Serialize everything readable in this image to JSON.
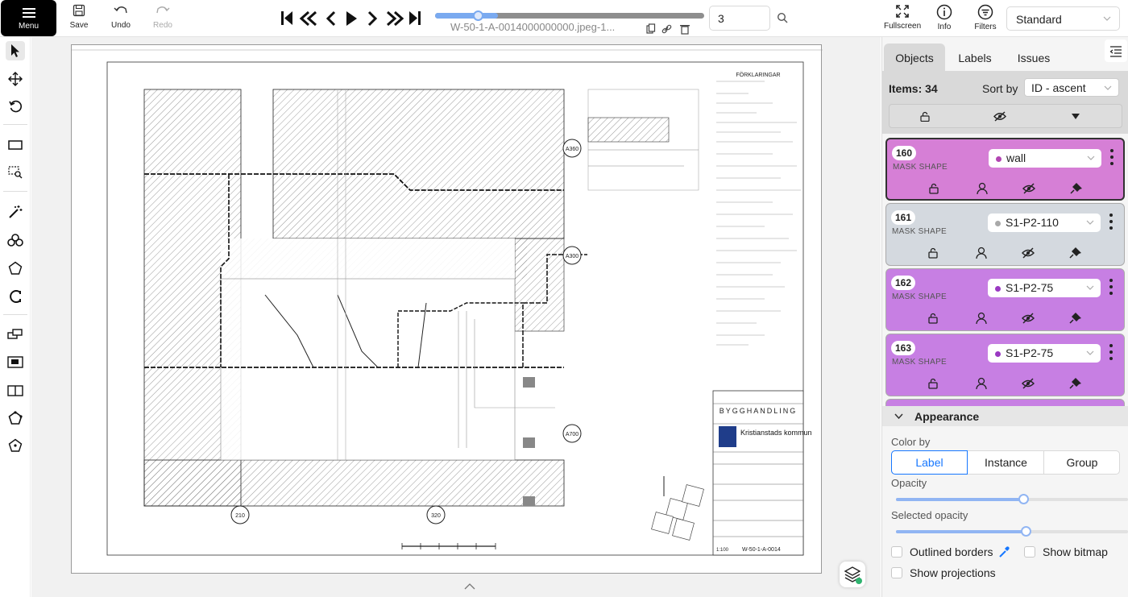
{
  "toolbar": {
    "menu_label": "Menu",
    "save_label": "Save",
    "undo_label": "Undo",
    "redo_label": "Redo",
    "filename": "W-50-1-A-0014000000000.jpeg-1...",
    "frame_value": "3",
    "fullscreen_label": "Fullscreen",
    "info_label": "Info",
    "filters_label": "Filters",
    "workspace_select": "Standard",
    "progress_fraction": 0.14
  },
  "sidebar": {
    "tabs": [
      "Objects",
      "Labels",
      "Issues"
    ],
    "items_count": "Items: 34",
    "sort_label": "Sort by",
    "sort_value": "ID - ascent",
    "objects": [
      {
        "id": "160",
        "kind": "MASK SHAPE",
        "label": "wall",
        "color": "#d67fd6",
        "dot": "#b245b2"
      },
      {
        "id": "161",
        "kind": "MASK SHAPE",
        "label": "S1-P2-110",
        "color": "#d4d9df",
        "dot": "#a9a9a9"
      },
      {
        "id": "162",
        "kind": "MASK SHAPE",
        "label": "S1-P2-75",
        "color": "#c77fe3",
        "dot": "#9a39c2"
      },
      {
        "id": "163",
        "kind": "MASK SHAPE",
        "label": "S1-P2-75",
        "color": "#c77fe3",
        "dot": "#9a39c2"
      }
    ]
  },
  "appearance": {
    "title": "Appearance",
    "color_by_label": "Color by",
    "color_by_options": [
      "Label",
      "Instance",
      "Group"
    ],
    "opacity_label": "Opacity",
    "opacity_value": 0.55,
    "selected_opacity_label": "Selected opacity",
    "selected_opacity_value": 0.56,
    "outlined_borders_label": "Outlined borders",
    "show_bitmap_label": "Show bitmap",
    "show_projections_label": "Show projections"
  },
  "drawing": {
    "grid_markers": [
      "A360",
      "A300",
      "A700",
      "210",
      "320"
    ],
    "title_block_heading": "FÖRKLARINGAR",
    "project": "BYGGHANDLING",
    "municipality": "Kristianstads kommun",
    "sheet_number": "W-50-1-A-0014",
    "scale": "1:100"
  }
}
